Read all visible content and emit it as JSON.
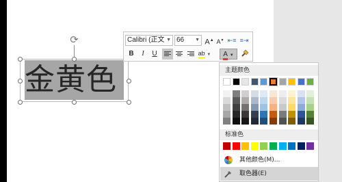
{
  "textbox": {
    "text": "金黄色"
  },
  "toolbar": {
    "font_name": "Calibri (正文",
    "font_size": "66",
    "grow_label": "A",
    "shrink_label": "A",
    "bold_label": "B",
    "italic_label": "I",
    "underline_label": "U",
    "highlight_label": "ab",
    "font_color_label": "A",
    "font_color": "#e03b2e"
  },
  "color_menu": {
    "theme_header": "主题颜色",
    "standard_header": "标准色",
    "more_colors": "其他颜色(M)...",
    "eyedropper": "取色器(E)",
    "selected_theme": "Orange",
    "theme_columns": [
      {
        "name": "White",
        "colors": [
          "#ffffff",
          "#f2f2f2",
          "#d9d9d9",
          "#bfbfbf",
          "#a6a6a6",
          "#7f7f7f"
        ]
      },
      {
        "name": "Black",
        "colors": [
          "#000000",
          "#7f7f7f",
          "#595959",
          "#404040",
          "#262626",
          "#0d0d0d"
        ]
      },
      {
        "name": "Gray",
        "colors": [
          "#e7e6e6",
          "#d0cece",
          "#aeabab",
          "#757171",
          "#3b3838",
          "#181717"
        ]
      },
      {
        "name": "Navy",
        "colors": [
          "#44546a",
          "#d6dce4",
          "#adb9ca",
          "#8497b0",
          "#333f4f",
          "#222a35"
        ]
      },
      {
        "name": "Blue",
        "colors": [
          "#5b9bd5",
          "#deebf6",
          "#bdd7ee",
          "#9cc3e5",
          "#2e75b5",
          "#1e4e79"
        ]
      },
      {
        "name": "Orange",
        "colors": [
          "#ed7d31",
          "#fbe5d5",
          "#f7cbac",
          "#f4b183",
          "#c55a11",
          "#833c0b"
        ]
      },
      {
        "name": "Silver",
        "colors": [
          "#a5a5a5",
          "#ededed",
          "#dbdbdb",
          "#c9c9c9",
          "#7b7b7b",
          "#525252"
        ]
      },
      {
        "name": "Gold",
        "colors": [
          "#ffc000",
          "#fff2cc",
          "#fee599",
          "#ffd965",
          "#bf9000",
          "#7f6000"
        ]
      },
      {
        "name": "Steel",
        "colors": [
          "#4472c4",
          "#d9e2f3",
          "#b4c6e7",
          "#8eaadb",
          "#2f5496",
          "#1f3864"
        ]
      },
      {
        "name": "Green",
        "colors": [
          "#70ad47",
          "#e2efd9",
          "#c5e0b3",
          "#a8d08d",
          "#538135",
          "#375623"
        ]
      }
    ],
    "standard_colors": [
      "#c00000",
      "#ff0000",
      "#ffc000",
      "#ffff00",
      "#92d050",
      "#00b050",
      "#00b0f0",
      "#0070c0",
      "#002060",
      "#7030a0"
    ]
  }
}
